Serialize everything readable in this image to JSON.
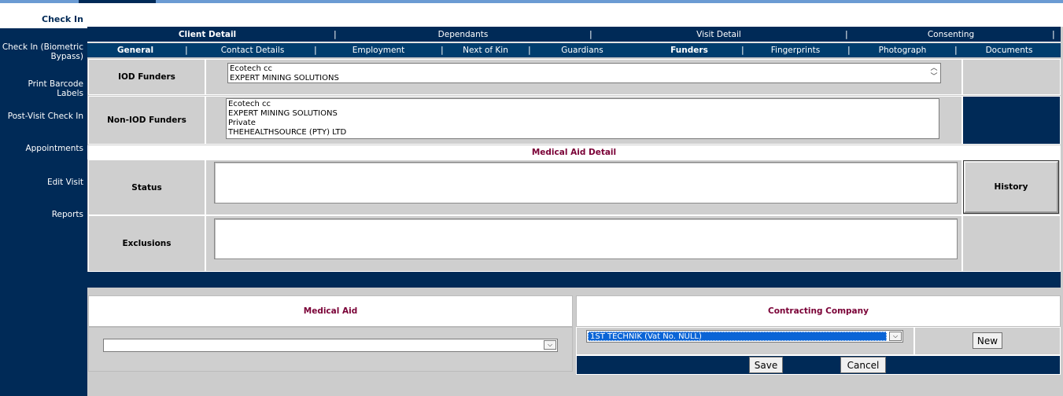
{
  "sidebar": {
    "active": "Check In",
    "items": [
      {
        "label": "Check In (Biometric Bypass)"
      },
      {
        "label": "Print Barcode Labels"
      },
      {
        "label": "Post-Visit Check In"
      },
      {
        "label": "Appointments"
      },
      {
        "label": "Edit Visit"
      },
      {
        "label": "Reports"
      }
    ]
  },
  "nav_primary": [
    "Client Detail",
    "Dependants",
    "Visit Detail",
    "Consenting"
  ],
  "nav_secondary": [
    "General",
    "Contact Details",
    "Employment",
    "Next of Kin",
    "Guardians",
    "Funders",
    "Fingerprints",
    "Photograph",
    "Documents"
  ],
  "nav_separator": "|",
  "funders": {
    "iod_label": "IOD Funders",
    "iod_items": [
      "Ecotech cc",
      "EXPERT MINING SOLUTIONS"
    ],
    "non_iod_label": "Non-IOD Funders",
    "non_iod_items": [
      "Ecotech cc",
      "EXPERT MINING SOLUTIONS",
      "Private",
      "THEHEALTHSOURCE (PTY) LTD"
    ]
  },
  "medical_aid_detail": {
    "title": "Medical Aid Detail",
    "status_label": "Status",
    "status_value": "",
    "exclusions_label": "Exclusions",
    "exclusions_value": "",
    "history_button": "History"
  },
  "medical_aid": {
    "heading": "Medical Aid",
    "selected": ""
  },
  "contracting_company": {
    "heading": "Contracting Company",
    "selected": "1ST TECHNIK (Vat No. NULL)",
    "new_button": "New"
  },
  "actions": {
    "save": "Save",
    "cancel": "Cancel"
  },
  "icons": {
    "dropdown": "chevron-down-icon",
    "scroll": "scroll-arrows-icon"
  },
  "colors": {
    "navy": "#002a57",
    "accent_text": "#7a0036",
    "selection": "#0a64d6"
  }
}
